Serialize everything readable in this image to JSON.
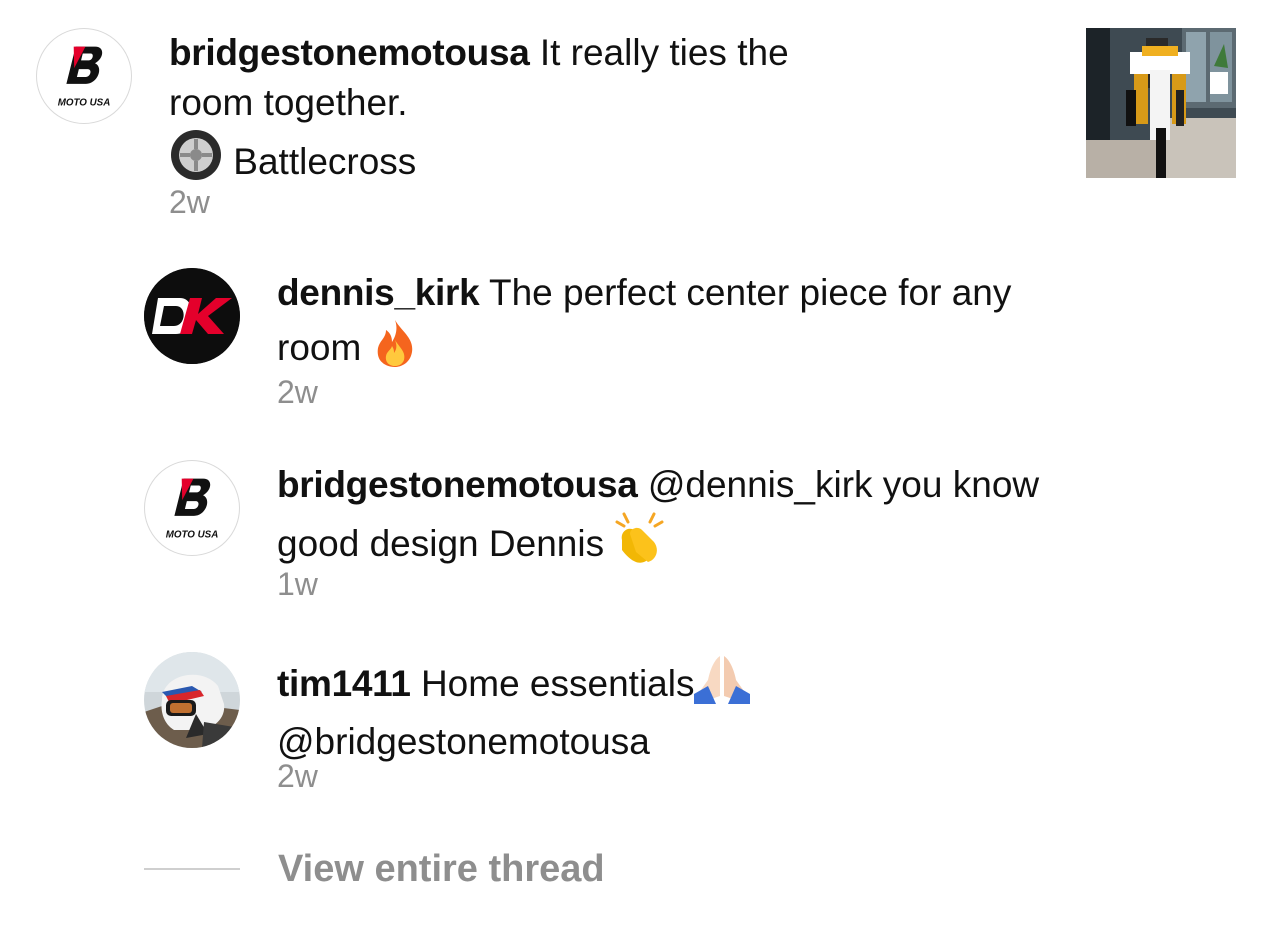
{
  "comments": [
    {
      "username": "bridgestonemotousa",
      "text_line1": "It really ties the",
      "text_line2": "room together.",
      "text_line3": "Battlecross",
      "timestamp": "2w",
      "avatar_label": "MOTO USA",
      "avatar_icon": "bridgestone-b-logo",
      "line3_icon": "tire-icon"
    },
    {
      "username": "dennis_kirk",
      "text_line1": "The perfect center piece for any",
      "text_line2": "room",
      "timestamp": "2w",
      "avatar_icon": "dk-logo",
      "emoji": "fire-emoji"
    },
    {
      "username": "bridgestonemotousa",
      "text_line1": "@dennis_kirk you know",
      "text_line2": "good design Dennis",
      "timestamp": "1w",
      "avatar_label": "MOTO USA",
      "avatar_icon": "bridgestone-b-logo",
      "emoji": "clapping-hands-emoji"
    },
    {
      "username": "tim1411",
      "text_line1": "Home essentials",
      "text_line2": "@bridgestonemotousa",
      "timestamp": "2w",
      "avatar_icon": "helmet-rider-photo",
      "emoji": "folded-hands-emoji"
    }
  ],
  "post_thumbnail": "motorcycle-in-living-room-photo",
  "view_thread_label": "View entire thread",
  "colors": {
    "text": "#111111",
    "muted": "#8e8e8e",
    "bridgestone_red": "#e4002b",
    "divider": "#cfcfcf"
  }
}
